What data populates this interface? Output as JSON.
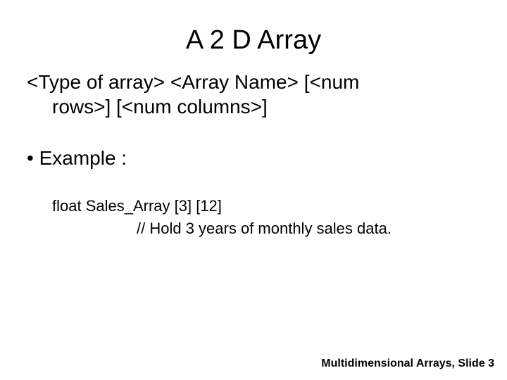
{
  "title": "A 2 D Array",
  "syntax_line1": "<Type of array> <Array Name> [<num",
  "syntax_line2": "rows>] [<num columns>]",
  "bullet_example": "Example :",
  "code_line1": "float Sales_Array [3] [12]",
  "code_line2": "// Hold 3 years of monthly sales data.",
  "footer": "Multidimensional Arrays, Slide 3"
}
